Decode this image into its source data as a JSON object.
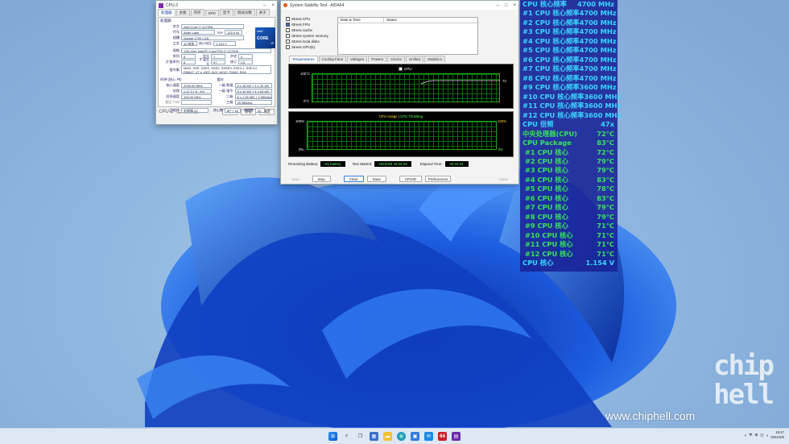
{
  "cpuz": {
    "title": "CPU-Z",
    "tabs": [
      "处理器",
      "主板",
      "内存",
      "SPD",
      "显卡",
      "测试分数",
      "关于"
    ],
    "section_processor": "处理器",
    "fields": [
      {
        "label": "名字",
        "value": "Intel Core i7-12700K"
      },
      {
        "label": "代号",
        "value": "Alder Lake"
      },
      {
        "label": "插槽",
        "value": "Socket 1700 LGA"
      },
      {
        "label": "工艺",
        "value": "10 纳米"
      },
      {
        "label": "规格",
        "value": "12th Gen Intel(R) Core(TM) i7-12700K"
      },
      {
        "label": "系列",
        "value": "6"
      },
      {
        "label": "扩展系列",
        "value": "6"
      },
      {
        "label": "指令集",
        "value": "MMX, SSE, SSE2, SSE3, SSSE3, SSE4.1, SSE4.2, EM64T, VT-x, AES, AVX, AVX2, FMA3, SHA"
      }
    ],
    "tdp_label": "TDP",
    "tdp_value": "125.0 W",
    "voltage_label": "核心电压",
    "voltage_value": "1.154 V",
    "model_label": "型号",
    "model_value": "7",
    "stepping_label": "步进",
    "stepping_value": "2",
    "ext_model_label": "扩展型号",
    "ext_model_value": "97",
    "revision_label": "修订",
    "revision_value": "C0",
    "clocks_section": "时钟 (核心 #0)",
    "cache_section": "缓存",
    "clocks": [
      {
        "label": "核心速度",
        "value": "4700.00 MHz"
      },
      {
        "label": "倍频",
        "value": "x 47.0 ( 8 - 49)"
      },
      {
        "label": "总线速度",
        "value": "100.00 MHz"
      },
      {
        "label": "额定 FSB",
        "value": ""
      }
    ],
    "cache": [
      {
        "label": "一级 数据",
        "value": "8 x 48 KB + 4 x 32 KB"
      },
      {
        "label": "一级 指令",
        "value": "8 x 32 KB + 4 x 64 KB"
      },
      {
        "label": "二级",
        "value": "8 x 1.25 MB + 2 MBytes"
      },
      {
        "label": "三级",
        "value": "25 MBytes"
      }
    ],
    "selected_label": "已选择",
    "selected_value": "处理器 #1",
    "cores_label": "核心数",
    "cores_value": "8P + 4E",
    "threads_label": "线程数",
    "threads_value": "20",
    "footer_logo": "CPU-Z",
    "version": "Ver. 1.99.0.x64",
    "tools_btn": "工具",
    "validate_btn": "验证",
    "ok_btn": "确定",
    "intel_badge": "intel",
    "core_badge": "CORE",
    "i7_badge": "i7"
  },
  "aida": {
    "title": "System Stability Test - AIDA64",
    "stress": [
      {
        "label": "Stress CPU",
        "checked": false
      },
      {
        "label": "Stress FPU",
        "checked": true
      },
      {
        "label": "Stress cache",
        "checked": false
      },
      {
        "label": "Stress system memory",
        "checked": false
      },
      {
        "label": "Stress local disks",
        "checked": false
      },
      {
        "label": "Stress GPU(s)",
        "checked": false
      }
    ],
    "log_col1": "Date & Time",
    "log_col2": "Status",
    "tabs": [
      "Temperatures",
      "Cooling Fans",
      "Voltages",
      "Powers",
      "Clocks",
      "Unified",
      "Statistics"
    ],
    "temp_legend": "CPU",
    "temp_top": "100°C",
    "temp_bottom": "0°C",
    "temp_reading": "72",
    "usage_title": "CPU Usage",
    "usage_sep": "|",
    "usage_title2": "CPU Throttling",
    "usage_top_left": "100%",
    "usage_bottom_left": "0%",
    "usage_top_right": "100%",
    "usage_bottom_right": "0%",
    "remaining_label": "Remaining Battery:",
    "remaining_value": "No battery",
    "started_label": "Test Started:",
    "started_value": "2022/3/9 19:26:29",
    "elapsed_label": "Elapsed Time:",
    "elapsed_value": "00:10:21",
    "buttons": {
      "start": "Start",
      "stop": "Stop",
      "clear": "Clear",
      "save": "Save",
      "cpuid": "CPUID",
      "preferences": "Preferences",
      "close": "Close"
    }
  },
  "osd": [
    {
      "label": "CPU 核心频率",
      "value": "4700 MHz",
      "color": "cyan"
    },
    {
      "label": "#1 CPU 核心频率",
      "value": "4700 MHz",
      "color": "cyan"
    },
    {
      "label": "#2 CPU 核心频率",
      "value": "4700 MHz",
      "color": "cyan"
    },
    {
      "label": "#3 CPU 核心频率",
      "value": "4700 MHz",
      "color": "cyan"
    },
    {
      "label": "#4 CPU 核心频率",
      "value": "4700 MHz",
      "color": "cyan"
    },
    {
      "label": "#5 CPU 核心频率",
      "value": "4700 MHz",
      "color": "cyan"
    },
    {
      "label": "#6 CPU 核心频率",
      "value": "4700 MHz",
      "color": "cyan"
    },
    {
      "label": "#7 CPU 核心频率",
      "value": "4700 MHz",
      "color": "cyan"
    },
    {
      "label": "#8 CPU 核心频率",
      "value": "4700 MHz",
      "color": "cyan"
    },
    {
      "label": "#9 CPU 核心频率",
      "value": "3600 MHz",
      "color": "cyan"
    },
    {
      "label": "#10 CPU 核心频率",
      "value": "3600 MHz",
      "color": "cyan"
    },
    {
      "label": "#11 CPU 核心频率",
      "value": "3600 MHz",
      "color": "cyan"
    },
    {
      "label": "#12 CPU 核心频率",
      "value": "3600 MHz",
      "color": "cyan"
    },
    {
      "label": "CPU 倍频",
      "value": "47x",
      "color": "cyan"
    },
    {
      "label": "中央处理器(CPU)",
      "value": "72°C",
      "color": "green"
    },
    {
      "label": "CPU Package",
      "value": "83°C",
      "color": "green"
    },
    {
      "label": " #1 CPU 核心",
      "value": "72°C",
      "color": "green"
    },
    {
      "label": " #2 CPU 核心",
      "value": "79°C",
      "color": "green"
    },
    {
      "label": " #3 CPU 核心",
      "value": "79°C",
      "color": "green"
    },
    {
      "label": " #4 CPU 核心",
      "value": "83°C",
      "color": "green"
    },
    {
      "label": " #5 CPU 核心",
      "value": "78°C",
      "color": "green"
    },
    {
      "label": " #6 CPU 核心",
      "value": "83°C",
      "color": "green"
    },
    {
      "label": " #7 CPU 核心",
      "value": "79°C",
      "color": "green"
    },
    {
      "label": " #8 CPU 核心",
      "value": "79°C",
      "color": "green"
    },
    {
      "label": " #9 CPU 核心",
      "value": "71°C",
      "color": "green"
    },
    {
      "label": " #10 CPU 核心",
      "value": "71°C",
      "color": "green"
    },
    {
      "label": " #11 CPU 核心",
      "value": "71°C",
      "color": "green"
    },
    {
      "label": " #12 CPU 核心",
      "value": "71°C",
      "color": "green"
    },
    {
      "label": "CPU 核心",
      "value": "1.154 V",
      "color": "cyan"
    }
  ],
  "watermark": {
    "url": "www.chiphell.com",
    "logo_text": "chip hell"
  },
  "taskbar": {
    "tray_lang": "中",
    "clock_time": "19:47",
    "clock_date": "2022/3/9",
    "aida_badge": "64"
  },
  "colors": {
    "osd_bg": "#182296",
    "osd_cyan": "#3ad6ff",
    "osd_green": "#35e35a",
    "graph_grid": "#0a6a0a",
    "accent": "#2a6fd0"
  }
}
